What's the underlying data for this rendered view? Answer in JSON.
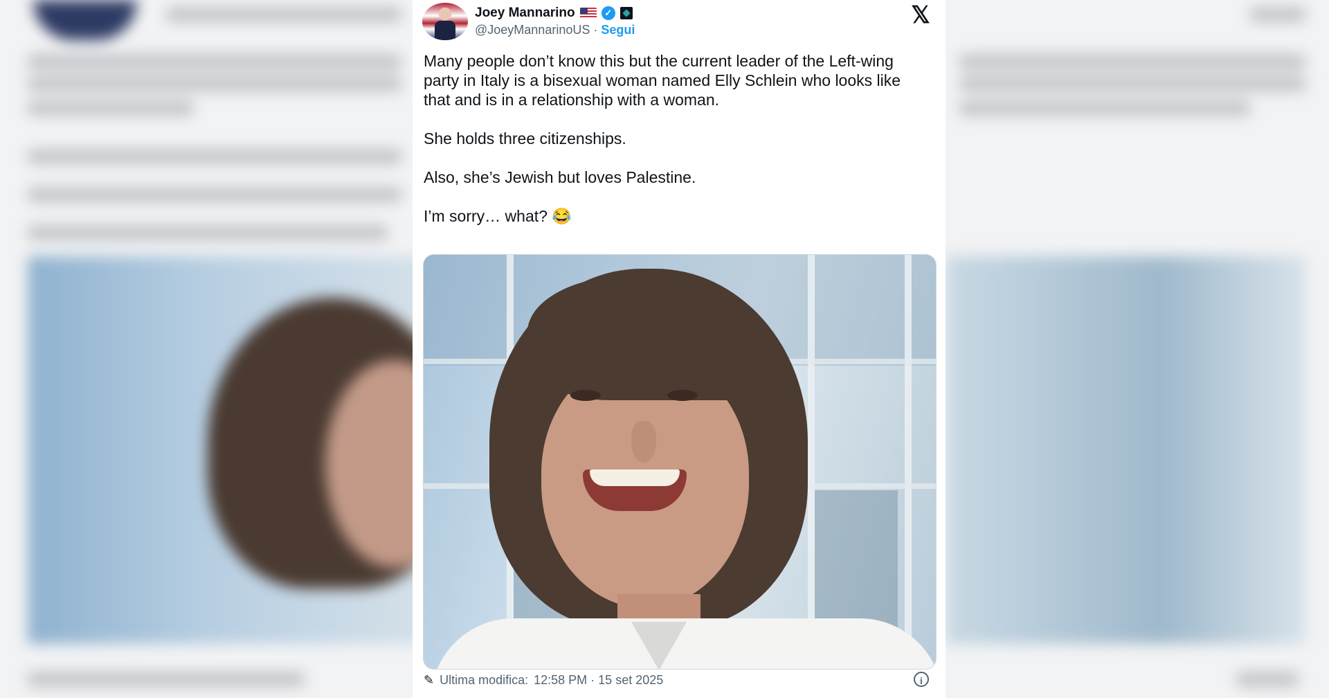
{
  "tweet": {
    "author_name": "Joey Mannarino",
    "handle": "@JoeyMannarinoUS",
    "separator": "·",
    "follow_label": "Segui",
    "paragraphs": [
      "Many people don’t know this but the current leader of the Left-wing party in Italy is a bisexual woman named Elly Schlein who looks like that and is in a relationship with a woman.",
      "She holds three citizenships.",
      "Also, she’s Jewish but loves Palestine.",
      "I’m sorry… what? 😂"
    ],
    "footer_label": "Ultima modifica:",
    "timestamp": "12:58 PM · 15 set 2025",
    "icons": {
      "flag": "us-flag-icon",
      "verified": "verified-badge-icon",
      "affiliation": "affiliation-badge-icon",
      "brand": "x-logo-icon",
      "edit": "pencil-icon",
      "info": "info-icon"
    },
    "colors": {
      "link": "#1d9bf0",
      "text": "#0f1419",
      "muted": "#536471"
    }
  }
}
